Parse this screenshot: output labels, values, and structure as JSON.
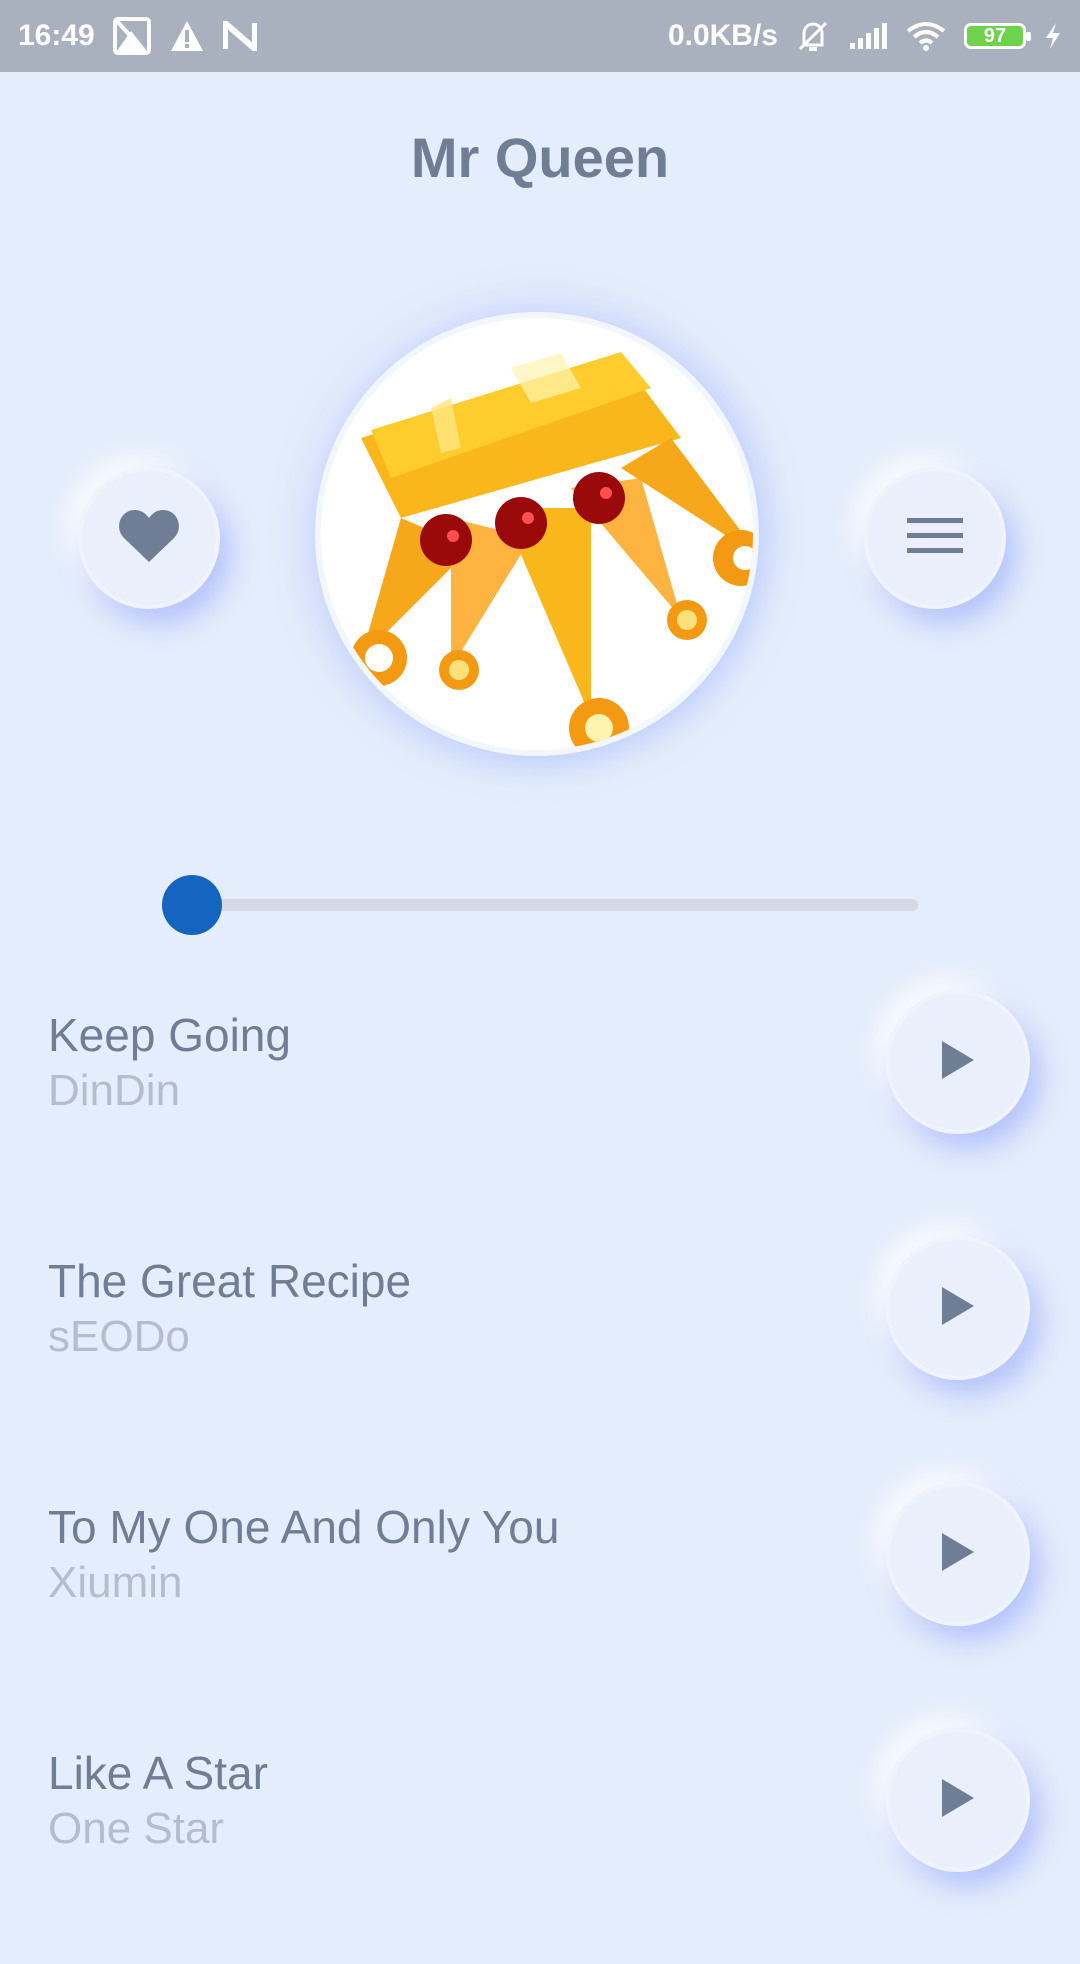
{
  "status_bar": {
    "time": "16:49",
    "net_speed": "0.0KB/s",
    "battery": "97",
    "icons": [
      "gallery-icon",
      "warning-icon",
      "n-icon",
      "mute-icon",
      "signal-icon",
      "wifi-icon",
      "battery-icon",
      "charging-icon"
    ]
  },
  "header": {
    "title": "Mr Queen"
  },
  "controls": {
    "favorite_icon": "heart-icon",
    "menu_icon": "menu-icon"
  },
  "album": {
    "art": "crown-illustration"
  },
  "progress": {
    "fraction": 0.03
  },
  "colors": {
    "background": "#e4edfb",
    "accent": "#1565c0",
    "text_primary": "#6f7d95",
    "text_secondary": "#b5bdcc"
  },
  "songs": [
    {
      "title": "Keep Going",
      "artist": "DinDin"
    },
    {
      "title": "The Great Recipe",
      "artist": "sEODo"
    },
    {
      "title": "To My One And Only You",
      "artist": "Xiumin"
    },
    {
      "title": "Like A Star",
      "artist": "One Star"
    }
  ]
}
